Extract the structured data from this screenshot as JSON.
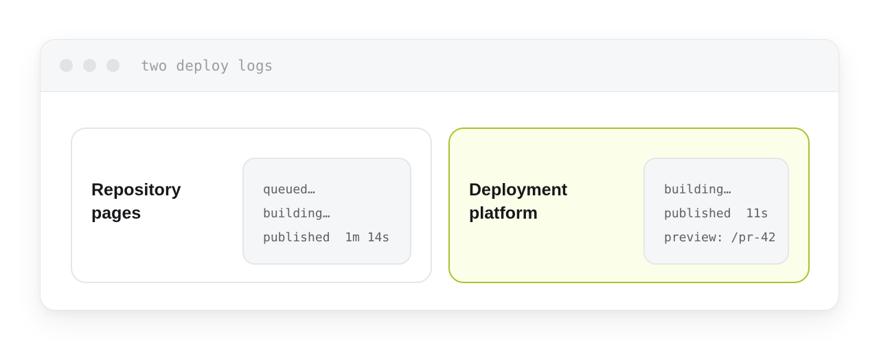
{
  "window": {
    "title": "two deploy logs"
  },
  "panels": [
    {
      "title": "Repository pages",
      "log": [
        "queued…",
        "building…",
        "published  1m 14s"
      ]
    },
    {
      "title": "Deployment platform",
      "log": [
        "building…",
        "published  11s",
        "preview: /pr-42"
      ]
    }
  ],
  "colors": {
    "highlight_background": "#fbfee8",
    "highlight_border": "#a9c22d"
  }
}
